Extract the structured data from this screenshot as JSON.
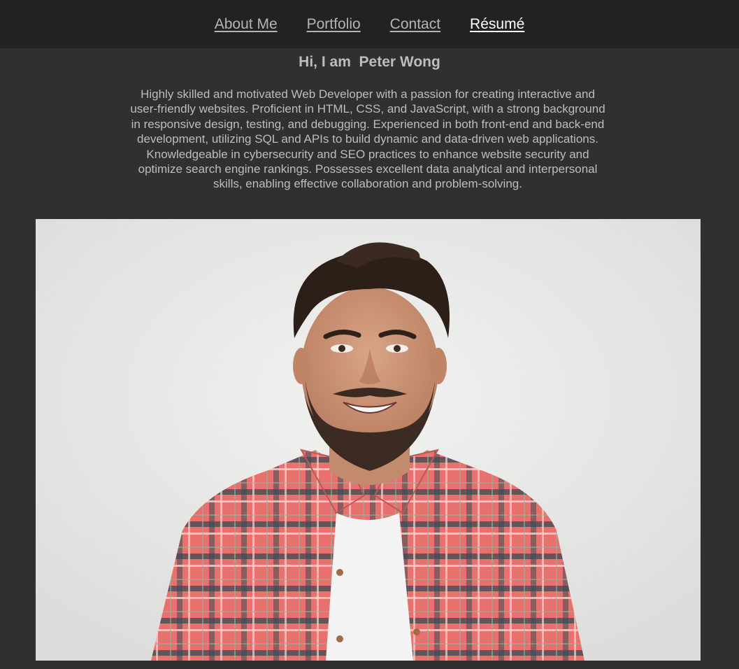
{
  "nav": {
    "items": [
      {
        "label": "About Me",
        "active": false
      },
      {
        "label": "Portfolio",
        "active": false
      },
      {
        "label": "Contact",
        "active": false
      },
      {
        "label": "Résumé",
        "active": true
      }
    ]
  },
  "hero": {
    "title": "Hi, I am  Peter Wong",
    "bio": "Highly skilled and motivated Web Developer with a passion for creating interactive and user-friendly websites. Proficient in HTML, CSS, and JavaScript, with a strong background in responsive design, testing, and debugging. Experienced in both front-end and back-end development, utilizing SQL and APIs to build dynamic and data-driven web applications. Knowledgeable in cybersecurity and SEO practices to enhance website security and optimize search engine rankings. Possesses excellent data analytical and interpersonal skills, enabling effective collaboration and problem-solving."
  },
  "colors": {
    "page_bg": "#303030",
    "nav_bg": "#222222",
    "text": "#bdbdbd",
    "active_link": "#ffffff"
  }
}
